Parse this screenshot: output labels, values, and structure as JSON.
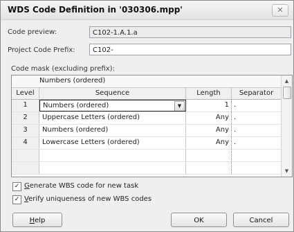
{
  "dialog": {
    "title": "WDS Code Definition in '030306.mpp'",
    "close_icon": "close-icon"
  },
  "code_preview": {
    "label": "Code preview:",
    "value": "C102-1.A.1.a"
  },
  "project_prefix": {
    "label": "Project Code Prefix:",
    "value": "C102-"
  },
  "code_mask": {
    "label": "Code mask (excluding prefix):",
    "top_row": "Numbers (ordered)",
    "columns": [
      "Level",
      "Sequence",
      "Length",
      "Separator"
    ],
    "rows": [
      {
        "level": "1",
        "sequence": "Numbers (ordered)",
        "length": "1",
        "separator": "."
      },
      {
        "level": "2",
        "sequence": "Uppercase Letters (ordered)",
        "length": "Any",
        "separator": "."
      },
      {
        "level": "3",
        "sequence": "Numbers (ordered)",
        "length": "Any",
        "separator": "."
      },
      {
        "level": "4",
        "sequence": "Lowercase Letters (ordered)",
        "length": "Any",
        "separator": "."
      },
      {
        "level": "",
        "sequence": "",
        "length": "",
        "separator": ""
      },
      {
        "level": "",
        "sequence": "",
        "length": "",
        "separator": ""
      }
    ]
  },
  "options": {
    "generate_prefix": "G",
    "generate_rest": "enerate WBS code for new task",
    "generate_checked": true,
    "verify_prefix": "V",
    "verify_rest": "erify uniqueness of new WBS codes",
    "verify_checked": true
  },
  "buttons": {
    "help_prefix": "H",
    "help_rest": "elp",
    "ok": "OK",
    "cancel": "Cancel"
  }
}
